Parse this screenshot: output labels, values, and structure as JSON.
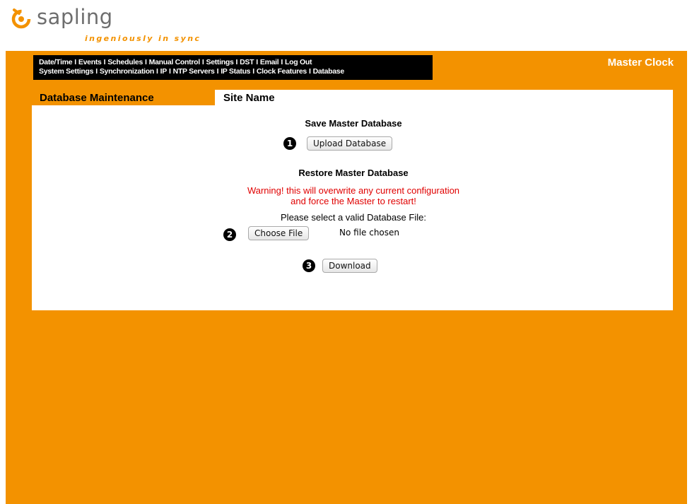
{
  "brand": {
    "name": "sapling",
    "tagline": "ingeniously in sync",
    "accent_color": "#f39200"
  },
  "nav": {
    "row1": [
      "Date/Time",
      "Events",
      "Schedules",
      "Manual Control",
      "Settings",
      "DST",
      "Email",
      "Log Out"
    ],
    "row2": [
      "System Settings",
      "Synchronization",
      "IP",
      "NTP Servers",
      "IP Status",
      "Clock Features",
      "Database"
    ],
    "separator": "I"
  },
  "header": {
    "device_title": "Master Clock"
  },
  "sidebar": {
    "section_title": "Database Maintenance"
  },
  "main": {
    "site_name": "Site Name",
    "save": {
      "heading": "Save Master Database",
      "marker": "1",
      "button_label": "Upload Database"
    },
    "restore": {
      "heading": "Restore Master Database",
      "warning_line1": "Warning! this will overwrite any current configuration",
      "warning_line2": "and force the Master to restart!",
      "select_prompt": "Please select a valid Database File:",
      "marker_file": "2",
      "choose_file_label": "Choose File",
      "file_status": "No file chosen",
      "marker_download": "3",
      "download_label": "Download"
    }
  },
  "colors": {
    "warning": "#e00000",
    "nav_background": "#000000"
  },
  "icons": {
    "logo": "sapling-swirl-icon"
  }
}
